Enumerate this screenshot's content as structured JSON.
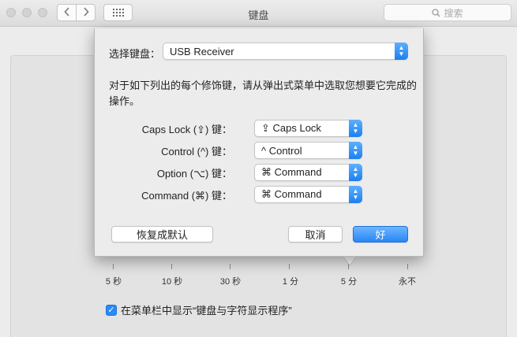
{
  "window": {
    "title": "键盘",
    "search_placeholder": "搜索"
  },
  "slider": {
    "ticks": [
      "5 秒",
      "10 秒",
      "30 秒",
      "1 分",
      "5 分",
      "永不"
    ],
    "selected_index": 4
  },
  "menu_bar_option": {
    "label": "在菜单栏中显示“键盘与字符显示程序”",
    "checked": true
  },
  "sheet": {
    "select_keyboard_label": "选择键盘：",
    "keyboard_value": "USB Receiver",
    "description": "对于如下列出的每个修饰键，请从弹出式菜单中选取您想要它完成的操作。",
    "modifiers": [
      {
        "label": "Caps Lock (⇪) 键：",
        "value": "⇪ Caps Lock"
      },
      {
        "label": "Control (^) 键：",
        "value": "^ Control"
      },
      {
        "label": "Option (⌥) 键：",
        "value": "⌘ Command"
      },
      {
        "label": "Command (⌘) 键：",
        "value": "⌘ Command"
      }
    ],
    "restore_defaults_label": "恢复成默认",
    "cancel_label": "取消",
    "ok_label": "好"
  },
  "colors": {
    "accent": "#2a86f5",
    "window_bg": "#ececec"
  }
}
